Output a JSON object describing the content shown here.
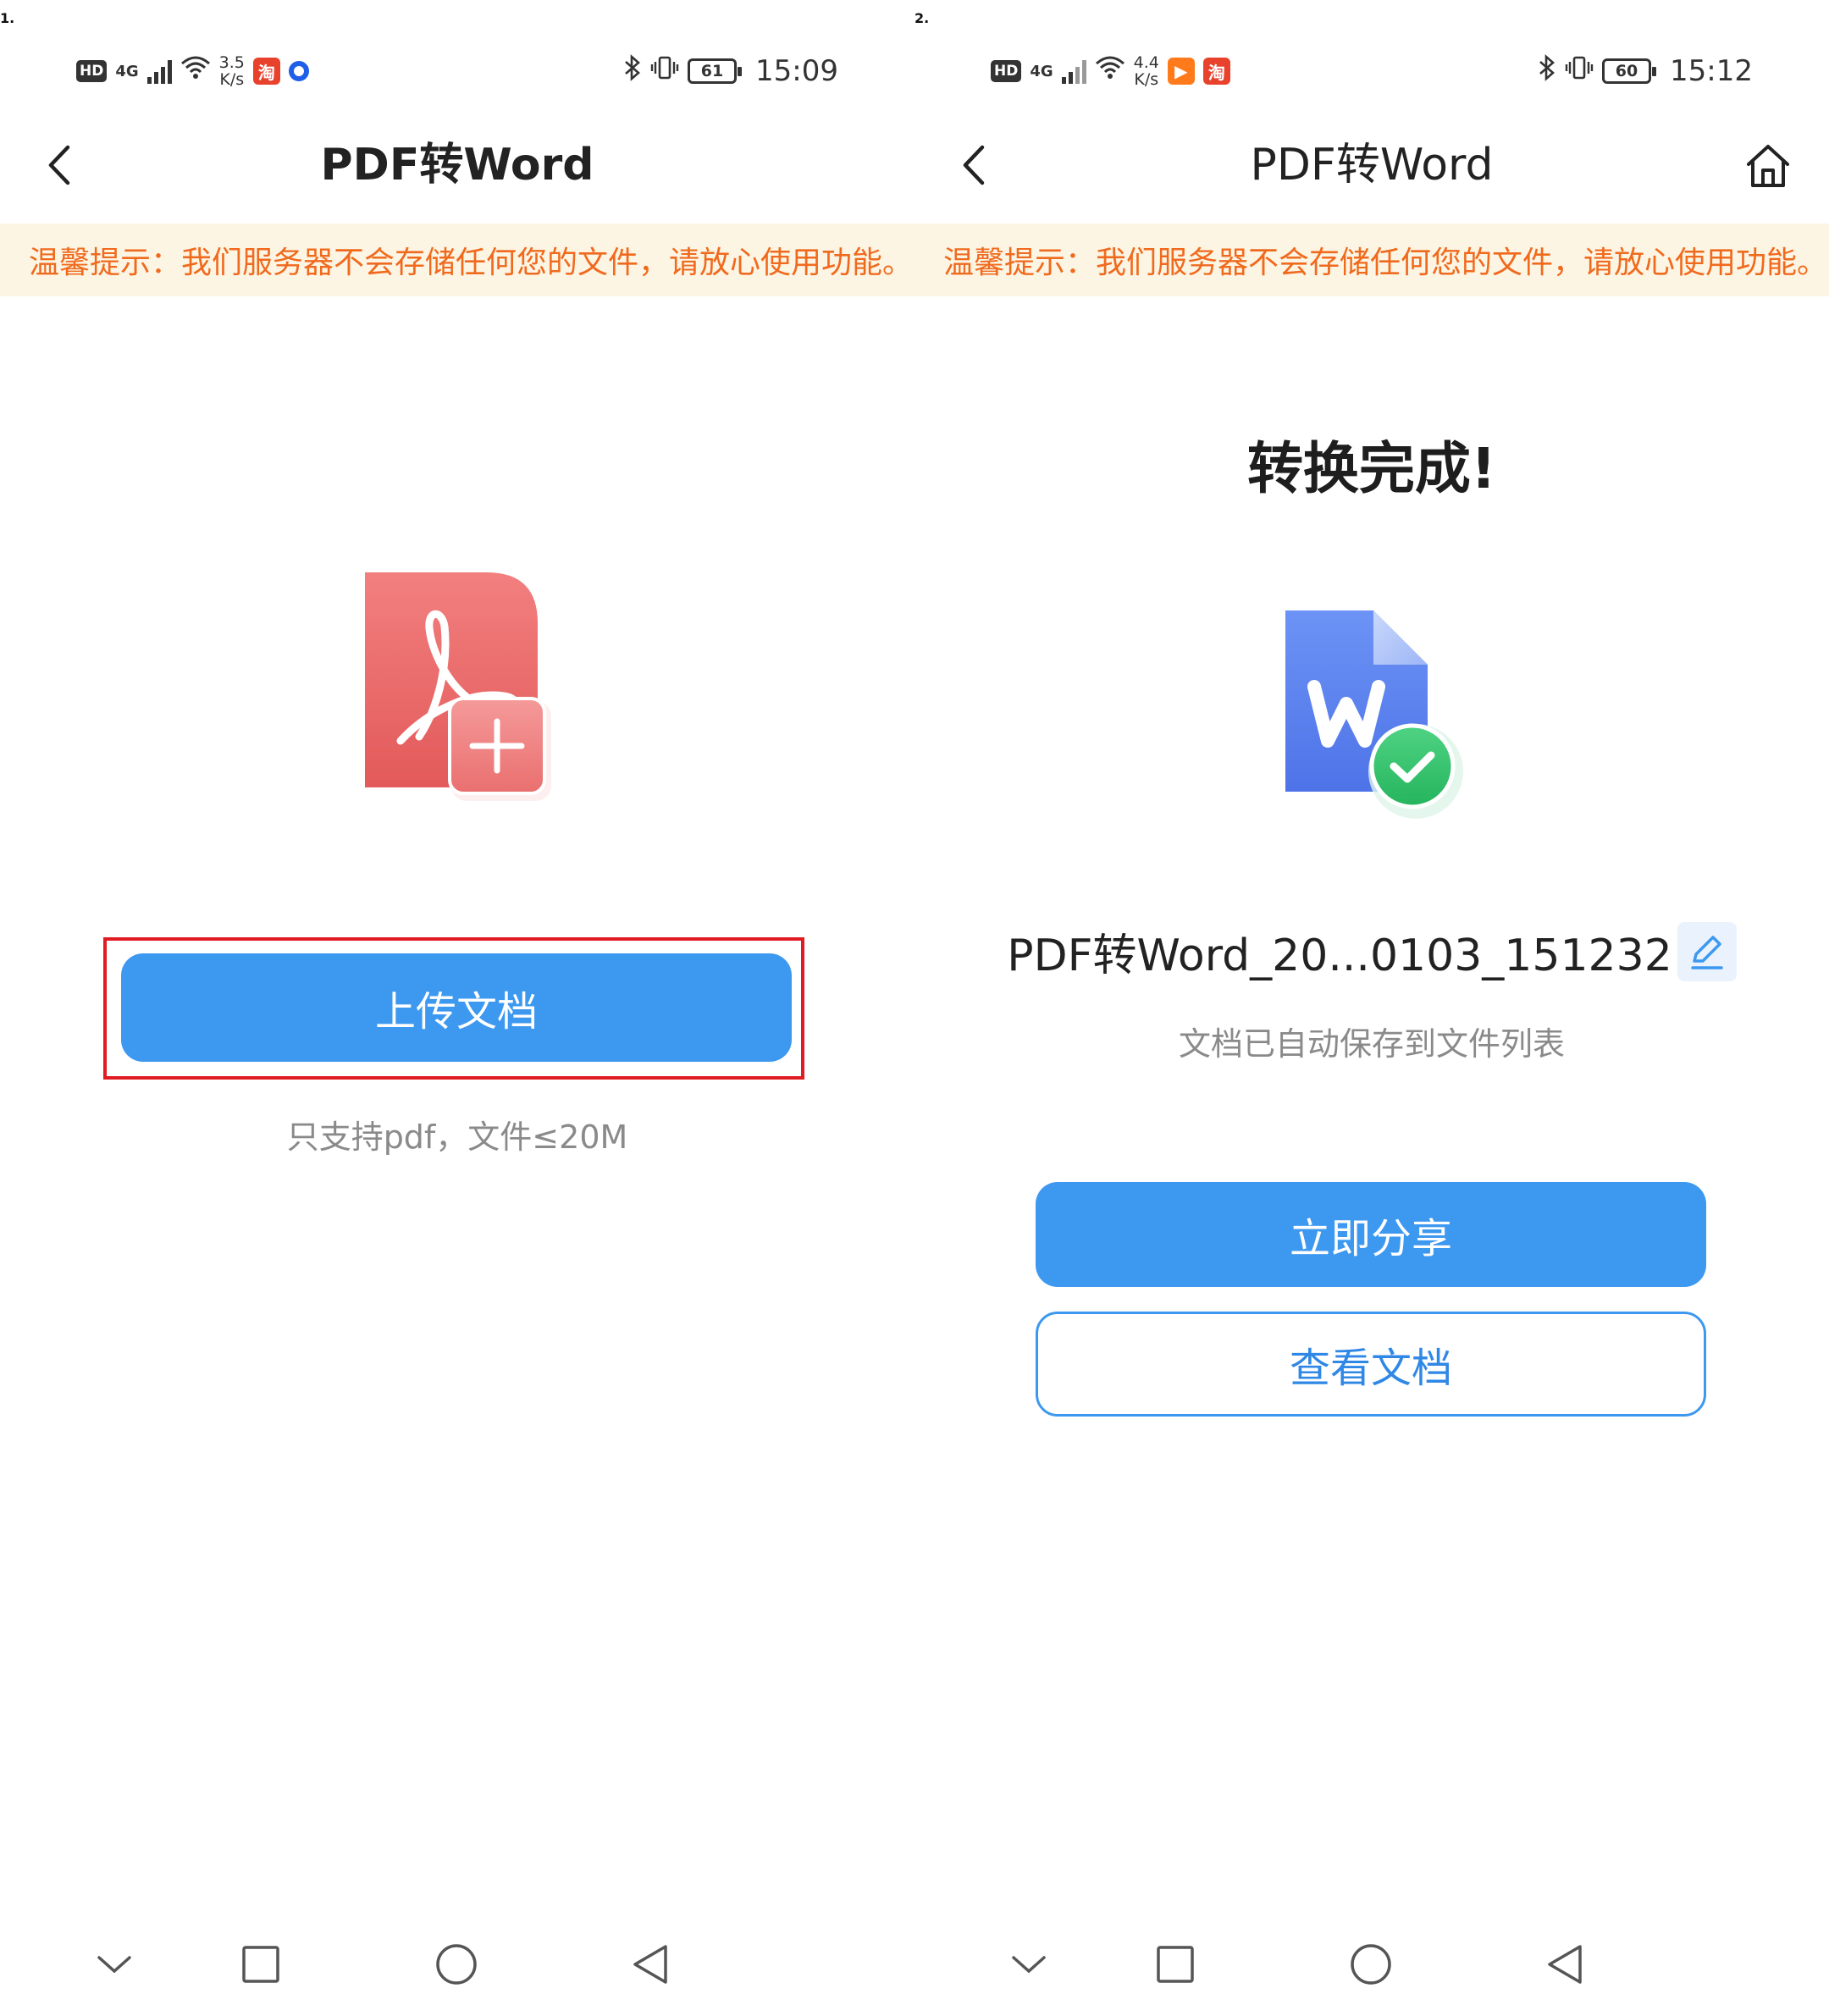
{
  "panels": [
    {
      "panel_label": "1.",
      "status": {
        "hd": "HD",
        "network": "4G",
        "speed_value": "3.5",
        "speed_unit": "K/s",
        "app_badge_1": "淘",
        "battery": "61",
        "time": "15:09"
      },
      "header": {
        "title": "PDF转Word"
      },
      "notice": "温馨提示：我们服务器不会存储任何您的文件，请放心使用功能。",
      "upload_button": "上传文档",
      "hint": "只支持pdf，文件≤20M"
    },
    {
      "panel_label": "2.",
      "status": {
        "hd": "HD",
        "network": "4G",
        "speed_value": "4.4",
        "speed_unit": "K/s",
        "app_badge_1": "▶",
        "app_badge_2": "淘",
        "battery": "60",
        "time": "15:12"
      },
      "header": {
        "title": "PDF转Word"
      },
      "notice": "温馨提示：我们服务器不会存储任何您的文件，请放心使用功能。",
      "result_title": "转换完成!",
      "file_name": "PDF转Word_20...0103_151232",
      "saved_hint": "文档已自动保存到文件列表",
      "share_button": "立即分享",
      "view_button": "查看文档"
    }
  ],
  "colors": {
    "primary": "#3d98f0",
    "notice_text": "#f06a1e",
    "notice_bg": "#fdf5e4",
    "highlight_frame": "#e01b22",
    "pdf_red": "#ef6b6b",
    "word_blue": "#5b84f0",
    "success_green": "#2ec26a"
  },
  "icons": {
    "back": "chevron-left-icon",
    "home": "home-icon",
    "edit": "pencil-icon",
    "nav": [
      "chevron-down-icon",
      "square-icon",
      "circle-icon",
      "triangle-back-icon"
    ]
  }
}
